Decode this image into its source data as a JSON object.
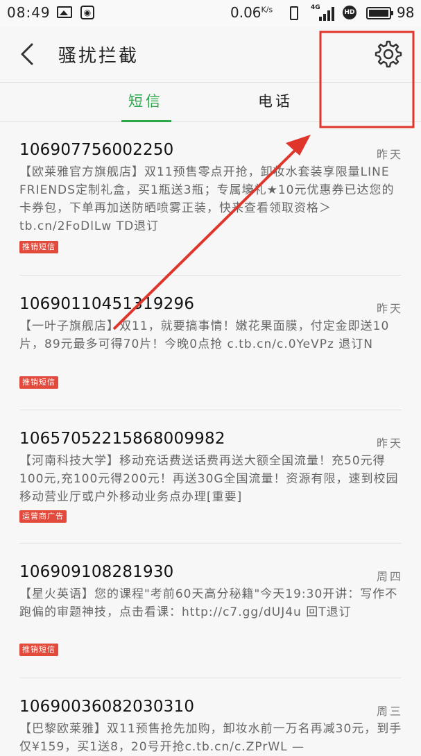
{
  "status_bar": {
    "time": "08:49",
    "speed": "0.06",
    "speed_unit": "K/s",
    "network": "4G",
    "hd": "HD",
    "battery": "98"
  },
  "header": {
    "title": "骚扰拦截"
  },
  "tabs": [
    {
      "label": "短信",
      "active": true
    },
    {
      "label": "电话",
      "active": false
    }
  ],
  "messages": [
    {
      "number": "106907756002250",
      "date": "昨天",
      "body": "【欧莱雅官方旗舰店】双11预售零点开抢，卸妆水套装享限量LINE FRIENDS定制礼盒，买1瓶送3瓶；专属壕礼★10元优惠券已达您的卡券包，下单再加送防晒喷雾正装，快来查看领取资格＞tb.cn/2FoDlLw TD退订",
      "badge": "推销短信"
    },
    {
      "number": "10690110451319296",
      "date": "昨天",
      "body": "【一叶子旗舰店】双11，就要搞事情！嫩花果面膜，付定金即送10片，89元最多可得70片！今晚0点抢 c.tb.cn/c.0YeVPz 退订N",
      "badge": "推销短信"
    },
    {
      "number": "10657052215868009982",
      "date": "昨天",
      "body": "【河南科技大学】移动充话费送话费再送大额全国流量！充50元得100元,充100元得200元！再送30G全国流量！资源有限，速到校园移动营业厅或户外移动业务点办理[重要]",
      "badge": "运营商广告"
    },
    {
      "number": "106909108281930",
      "date": "周四",
      "body": "【星火英语】您的课程\"考前60天高分秘籍\"今天19:30开讲：写作不跑偏的审题神技，点击看课：http://c7.gg/dUJ4u 回T退订",
      "badge": "推销短信"
    },
    {
      "number": "10690036082030310",
      "date": "周三",
      "body": "【巴黎欧莱雅】双11预售抢先加购，卸妆水前一万名再减30元，到手仅¥159，买1送8，20号开抢c.tb.cn/c.ZPrWL —",
      "badge": ""
    }
  ],
  "colors": {
    "accent": "#2aa84a",
    "badge": "#e24a3b",
    "annotation": "#e0352b"
  },
  "icons": {
    "back": "back-arrow-icon",
    "settings": "gear-icon"
  }
}
